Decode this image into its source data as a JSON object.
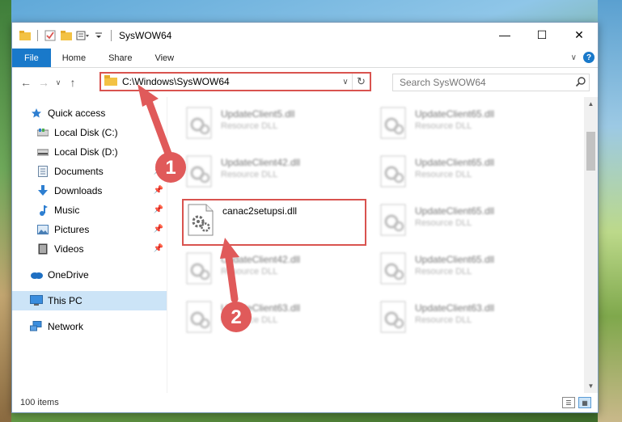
{
  "window": {
    "title": "SysWOW64",
    "controls": {
      "minimize": "—",
      "maximize": "☐",
      "close": "✕"
    }
  },
  "ribbon": {
    "tabs": [
      {
        "label": "File",
        "active": true
      },
      {
        "label": "Home"
      },
      {
        "label": "Share"
      },
      {
        "label": "View"
      }
    ],
    "expand_glyph": "∨",
    "help_glyph": "?"
  },
  "nav_buttons": {
    "back": "←",
    "forward": "→",
    "recent": "∨",
    "up": "↑"
  },
  "address": {
    "path": "C:\\Windows\\SysWOW64",
    "refresh_glyph": "↻",
    "dropdown_glyph": "∨"
  },
  "search": {
    "placeholder": "Search SysWOW64"
  },
  "sidebar": {
    "items": [
      {
        "label": "Quick access",
        "icon": "star-icon",
        "level": 0
      },
      {
        "label": "Local Disk (C:)",
        "icon": "drive-icon",
        "level": 1
      },
      {
        "label": "Local Disk (D:)",
        "icon": "drive-icon",
        "level": 1
      },
      {
        "label": "Documents",
        "icon": "documents-icon",
        "level": 1,
        "pinned": true
      },
      {
        "label": "Downloads",
        "icon": "downloads-icon",
        "level": 1,
        "pinned": true
      },
      {
        "label": "Music",
        "icon": "music-icon",
        "level": 1,
        "pinned": true
      },
      {
        "label": "Pictures",
        "icon": "pictures-icon",
        "level": 1,
        "pinned": true
      },
      {
        "label": "Videos",
        "icon": "videos-icon",
        "level": 1,
        "pinned": true
      },
      {
        "label": "OneDrive",
        "icon": "onedrive-icon",
        "level": 0
      },
      {
        "label": "This PC",
        "icon": "computer-icon",
        "level": 0,
        "selected": true
      },
      {
        "label": "Network",
        "icon": "network-icon",
        "level": 0
      }
    ],
    "pin_glyph": "📌"
  },
  "files": {
    "highlighted": {
      "name": "canac2setupsi.dll"
    },
    "blurred": [
      {
        "name": "UpdateClient5.dll",
        "type": "Resource DLL"
      },
      {
        "name": "UpdateClient65.dll",
        "type": "Resource DLL"
      },
      {
        "name": "UpdateClient42.dll",
        "type": "Resource DLL"
      },
      {
        "name": "UpdateClient65.dll",
        "type": "Resource DLL"
      },
      {
        "name": "UpdateClient65.dll",
        "type": "Resource DLL"
      },
      {
        "name": "UpdateClient42.dll",
        "type": "Resource DLL"
      },
      {
        "name": "UpdateClient65.dll",
        "type": "Resource DLL"
      },
      {
        "name": "UpdateClient63.dll",
        "type": "Resource DLL"
      },
      {
        "name": "UpdateClient63.dll",
        "type": "Resource DLL"
      }
    ]
  },
  "status": {
    "item_count": "100 items"
  },
  "annotations": {
    "step1": "1",
    "step2": "2"
  },
  "colors": {
    "accent": "#1979ca",
    "highlight": "#d9534f",
    "selection": "#cce4f7"
  }
}
